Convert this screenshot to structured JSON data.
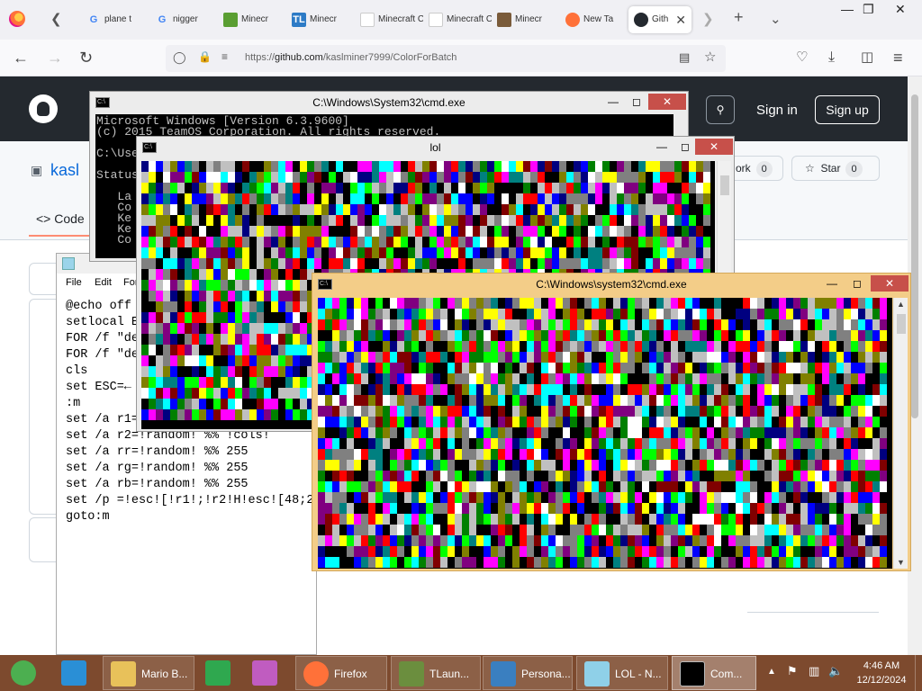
{
  "browser": {
    "tabs": [
      {
        "label": "plane t",
        "icon": "google-icon",
        "color": "#4285f4"
      },
      {
        "label": "nigger",
        "icon": "google-icon",
        "color": "#4285f4"
      },
      {
        "label": "Minecr",
        "icon": "minecraft-icon",
        "color": "#5a9e32"
      },
      {
        "label": "Minecr",
        "icon": "tl-icon",
        "color": "#2d7bc6"
      },
      {
        "label": "Minecraft C",
        "icon": "blank-icon",
        "color": "#ffffff"
      },
      {
        "label": "Minecraft C",
        "icon": "blank-icon",
        "color": "#ffffff"
      },
      {
        "label": "Minecr",
        "icon": "minecraft-block-icon",
        "color": "#7a5b3a"
      },
      {
        "label": "New Ta",
        "icon": "firefox-icon",
        "color": "#ff7139"
      },
      {
        "label": "Gith",
        "icon": "github-icon",
        "color": "#24292f"
      }
    ],
    "url_prefix": "https://",
    "url_host": "github.com",
    "url_path": "/kaslminer7999/ColorForBatch"
  },
  "github": {
    "sign_in": "Sign in",
    "sign_up": "Sign up",
    "repo_short": "kasl",
    "fork_label": "ork",
    "fork_count": "0",
    "star_label": "Star",
    "star_count": "0",
    "code_tab": "Code"
  },
  "windows": {
    "cmd_back": {
      "title": "C:\\Windows\\System32\\cmd.exe",
      "lines": [
        "Microsoft Windows [Version 6.3.9600]",
        "(c) 2015 TeamOS Corporation. All rights reserved.",
        "",
        "C:\\Use",
        "",
        "Status",
        "",
        "   La",
        "   Co",
        "   Ke",
        "   Ke",
        "   Co"
      ]
    },
    "lol": {
      "title": "lol"
    },
    "cmd_front": {
      "title": "C:\\Windows\\system32\\cmd.exe"
    }
  },
  "notepad": {
    "menu": [
      "File",
      "Edit",
      "For"
    ],
    "lines": [
      "@echo off",
      "setlocal E",
      "FOR /f \"de",
      "FOR /f \"de",
      "cls",
      "set ESC=←",
      ":m",
      "set /a r1=",
      "set /a r2=!random! %% !cols!",
      "set /a rr=!random! %% 255",
      "set /a rg=!random! %% 255",
      "set /a rb=!random! %% 255",
      "set /p =!esc![!r1!;!r2!H!esc![48;2",
      "goto:m"
    ]
  },
  "taskbar": {
    "items": [
      {
        "label": "",
        "icon": "chrome-icon",
        "color": "#4caf50"
      },
      {
        "label": "",
        "icon": "ie-icon",
        "color": "#2a8fd6"
      },
      {
        "label": "Mario B...",
        "icon": "folder-icon",
        "color": "#e8c15a"
      },
      {
        "label": "",
        "icon": "store-icon",
        "color": "#2fa84f"
      },
      {
        "label": "",
        "icon": "3d-app-icon",
        "color": "#c05cc0"
      },
      {
        "label": "Firefox",
        "icon": "firefox-icon",
        "color": "#ff7139"
      },
      {
        "label": "TLaun...",
        "icon": "minecraft-block-icon",
        "color": "#6b8e3e"
      },
      {
        "label": "Persona...",
        "icon": "personalize-icon",
        "color": "#3a7fc0"
      },
      {
        "label": "LOL - N...",
        "icon": "notepad-icon",
        "color": "#8fd0e8"
      },
      {
        "label": "Com...",
        "icon": "cmd-icon",
        "color": "#000000"
      }
    ],
    "time": "4:46 AM",
    "date": "12/12/2024"
  },
  "palette": [
    "#000000",
    "#000000",
    "#000000",
    "#c0c0c0",
    "#808080",
    "#ffffff",
    "#ff0000",
    "#800000",
    "#00ff00",
    "#008000",
    "#0000ff",
    "#000080",
    "#ffff00",
    "#808000",
    "#ff00ff",
    "#800080",
    "#00ffff",
    "#008080",
    "#808080",
    "#c0c0c0"
  ]
}
